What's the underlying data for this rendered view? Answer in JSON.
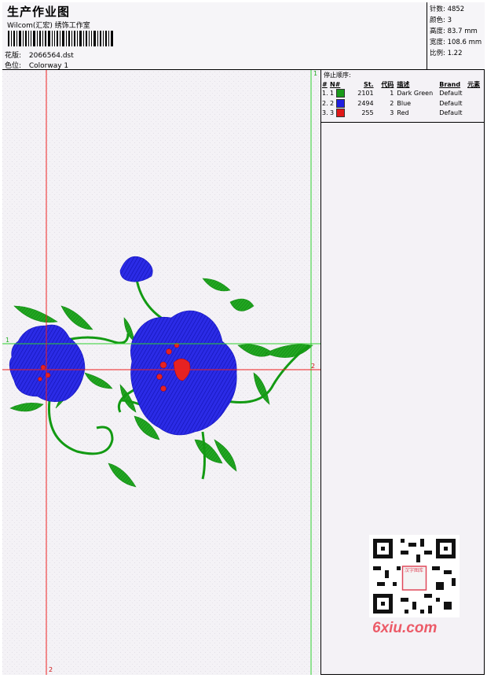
{
  "header": {
    "title": "生产作业图",
    "subtitle": "Wilcom(汇宏) 绣饰工作室",
    "design_label": "花版:",
    "design_value": "2066564.dst",
    "colorway_label": "色位:",
    "colorway_value": "Colorway 1"
  },
  "stats": {
    "stitches": "针数: 4852",
    "colors": "颜色: 3",
    "height": "高度: 83.7 mm",
    "width": "宽度: 108.6 mm",
    "scale": "比例: 1.22"
  },
  "legend": {
    "title": "停止顺序:",
    "headers": [
      "#",
      "N#",
      "St.",
      "代码",
      "描述",
      "Brand",
      "元素"
    ],
    "rows": [
      {
        "idx": "1.",
        "n": "1",
        "st": "2101",
        "code": "1",
        "desc": "Dark Green",
        "brand": "Default",
        "color": "#1a9a1a"
      },
      {
        "idx": "2.",
        "n": "2",
        "st": "2494",
        "code": "2",
        "desc": "Blue",
        "brand": "Default",
        "color": "#1f1fe0"
      },
      {
        "idx": "3.",
        "n": "3",
        "st": "255",
        "code": "3",
        "desc": "Red",
        "brand": "Default",
        "color": "#e01818"
      }
    ]
  },
  "guides": {
    "v_green_label": "1",
    "h_green_label": "1",
    "h_red_label": "2",
    "v_red_label": "2",
    "green_color": "#2ed12e",
    "red_color": "#ee2020"
  },
  "watermark": {
    "qr_badge": "汉字图库",
    "text": "6xiu.com"
  }
}
